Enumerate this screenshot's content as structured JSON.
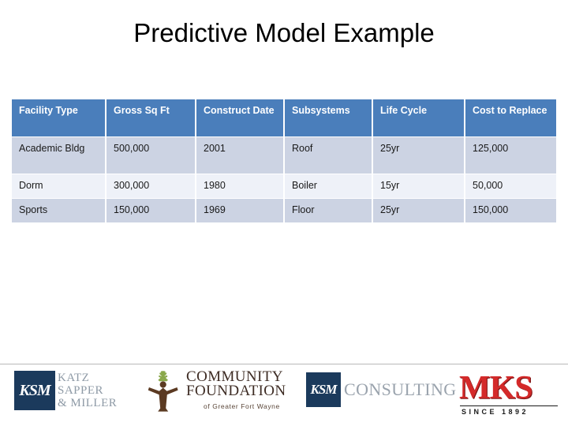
{
  "slide": {
    "title": "Predictive Model Example"
  },
  "table": {
    "columns": [
      "Facility Type",
      "Gross Sq Ft",
      "Construct Date",
      "Subsystems",
      "Life Cycle",
      "Cost to Replace"
    ],
    "rows": [
      {
        "facility_type": "Academic Bldg",
        "gross_sq_ft": "500,000",
        "construct_date": "2001",
        "subsystems": "Roof",
        "life_cycle": "25yr",
        "cost_to_replace": "125,000"
      },
      {
        "facility_type": "Dorm",
        "gross_sq_ft": "300,000",
        "construct_date": "1980",
        "subsystems": "Boiler",
        "life_cycle": "15yr",
        "cost_to_replace": "50,000"
      },
      {
        "facility_type": "Sports",
        "gross_sq_ft": "150,000",
        "construct_date": "1969",
        "subsystems": "Floor",
        "life_cycle": "25yr",
        "cost_to_replace": "150,000"
      }
    ],
    "colors": {
      "header_bg": "#4a7ebb",
      "header_text": "#ffffff",
      "row_odd_bg": "#ccd3e3",
      "row_even_bg": "#eef1f8",
      "cell_text": "#1a1a1a"
    }
  },
  "footer": {
    "logos": [
      {
        "mark": "KSM",
        "line1": "KATZ",
        "line2": "SAPPER",
        "line3": "& MILLER",
        "mark_bg": "#1b3a5c",
        "text_color": "#8e9aa6"
      },
      {
        "icon": "tree-icon",
        "line1": "COMMUNITY",
        "line2": "FOUNDATION",
        "line3": "of Greater Fort Wayne",
        "text_color": "#3d2b23",
        "leaf_color": "#8aa84b",
        "trunk_color": "#5b3a22"
      },
      {
        "mark": "KSM",
        "word": "CONSULTING",
        "mark_bg": "#1b3a5c",
        "text_color": "#9aa3ad"
      },
      {
        "word": "MKS",
        "tagline": "SINCE 1892",
        "text_color": "#d42a2a"
      }
    ]
  }
}
